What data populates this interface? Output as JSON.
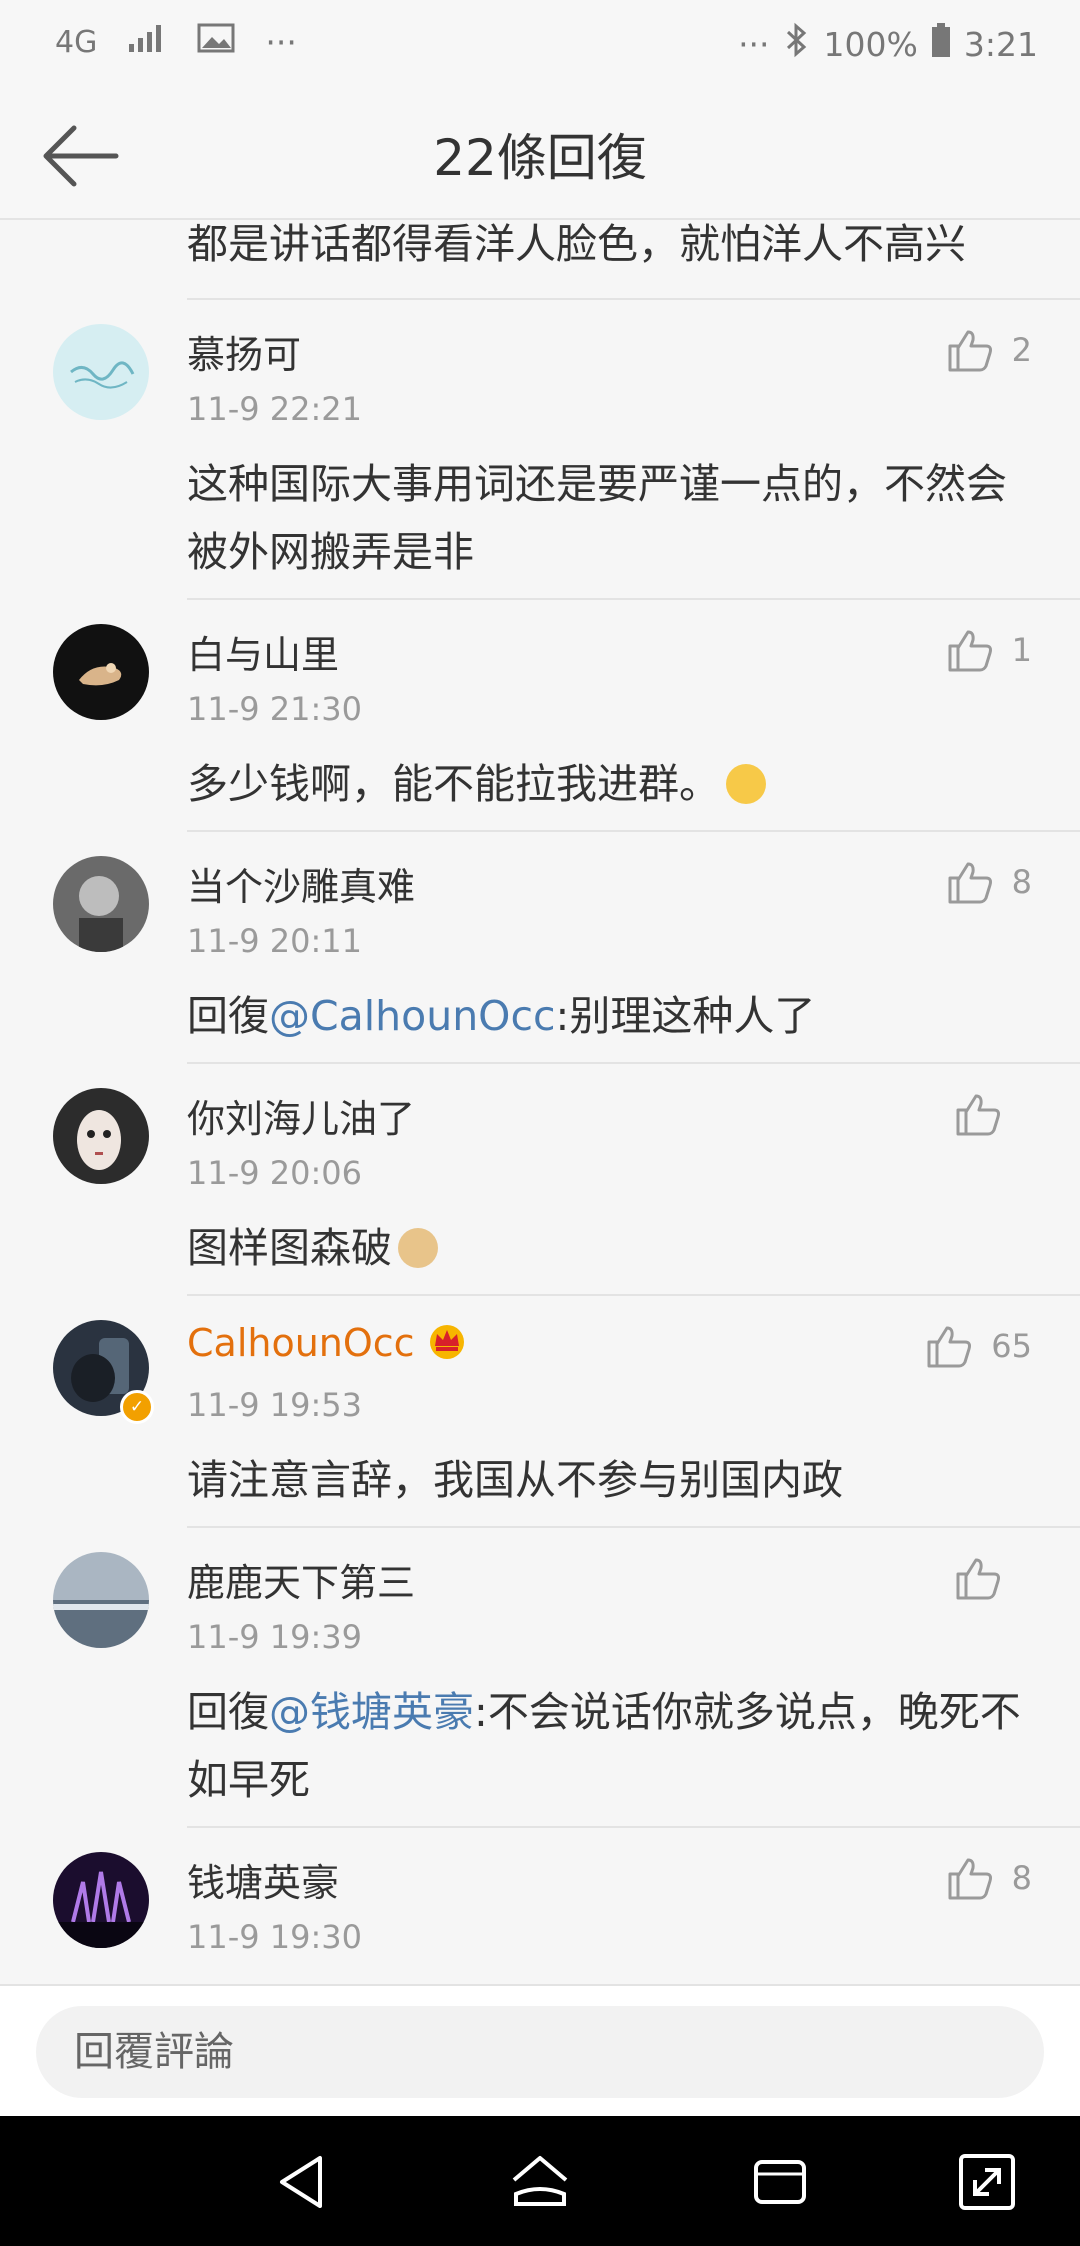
{
  "status_bar": {
    "network": "4G",
    "battery": "100%",
    "time": "3:21",
    "icons": [
      "signal-icon",
      "image-icon",
      "more-icon",
      "bluetooth-icon",
      "battery-icon"
    ]
  },
  "header": {
    "title": "22條回復",
    "back_icon": "back-arrow-icon"
  },
  "partial_comment_text": "都是讲话都得看洋人脸色，就怕洋人不高兴",
  "comments": [
    {
      "name": "慕扬可",
      "time": "11-9 22:21",
      "likes": "2",
      "text": "这种国际大事用词还是要严谨一点的，不然会被外网搬弄是非",
      "avatar_color": "#d6eef2"
    },
    {
      "name": "白与山里",
      "time": "11-9 21:30",
      "likes": "1",
      "text": "多少钱啊，能不能拉我进群。",
      "avatar_color": "#111111"
    },
    {
      "name": "当个沙雕真难",
      "time": "11-9 20:11",
      "likes": "8",
      "text_prefix": "回復",
      "mention": "@CalhounOcc",
      "text_suffix": ":别理这种人了",
      "avatar_color": "#555555"
    },
    {
      "name": "你刘海儿油了",
      "time": "11-9 20:06",
      "likes": "",
      "text": "图样图森破",
      "avatar_color": "#2c2c2c"
    },
    {
      "name": "CalhounOcc",
      "time": "11-9 19:53",
      "likes": "65",
      "text": "请注意言辞，我国从不参与别国内政",
      "avatar_color": "#2a3340"
    },
    {
      "name": "鹿鹿天下第三",
      "time": "11-9 19:39",
      "likes": "",
      "text_prefix": "回復",
      "mention": "@钱塘英豪",
      "text_suffix": ":不会说话你就多说点，晚死不如早死",
      "avatar_color": "#8a99a8"
    },
    {
      "name": "钱塘英豪",
      "time": "11-9 19:30",
      "likes": "8",
      "text": "",
      "avatar_color": "#3a1a5a"
    }
  ],
  "reply_bar": {
    "placeholder": "回覆評論"
  },
  "nav_bar": {
    "icons": [
      "nav-back-icon",
      "nav-home-icon",
      "nav-recents-icon",
      "nav-expand-icon"
    ]
  },
  "colors": {
    "accent_link": "#4a7bb0",
    "vip_name": "#e3700d",
    "muted_text": "#9a9a9a"
  }
}
